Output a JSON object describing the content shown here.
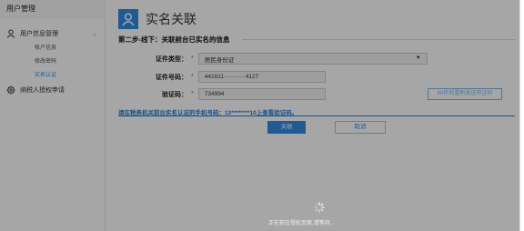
{
  "sidebar": {
    "header": "用户管理",
    "menu": {
      "label": "用户信息管理",
      "icon": "user-icon",
      "chevron": "⌄"
    },
    "submenu": [
      {
        "label": "帐户信息",
        "active": false
      },
      {
        "label": "修改密码",
        "active": false
      },
      {
        "label": "实名认证",
        "active": true
      }
    ],
    "menu2": {
      "label": "纳税人授权申请",
      "icon": "gear-icon"
    }
  },
  "main": {
    "title": "实名关联",
    "step": "第二步-线下：关联前台已实名的信息",
    "form": {
      "id_type_label": "证件类型：",
      "id_type_value": "居民身份证",
      "id_number_label": "证件号码：",
      "id_number_value": "441611···········4127",
      "code_label": "验证码：",
      "code_value": "734994",
      "required_mark": "*",
      "get_code_button": "60秒后重新发送验证码"
    },
    "tip": "请在税务机关前台实名认证的手机号码：13********10上查看验证码。",
    "ok_button": "关联",
    "cancel_button": "取消"
  },
  "overlay": {
    "loading_text": "正在前往授权页面,请等待..."
  },
  "colors": {
    "accent": "#2f8de4",
    "required": "#e4393c",
    "tip": "#1e7fd8"
  }
}
